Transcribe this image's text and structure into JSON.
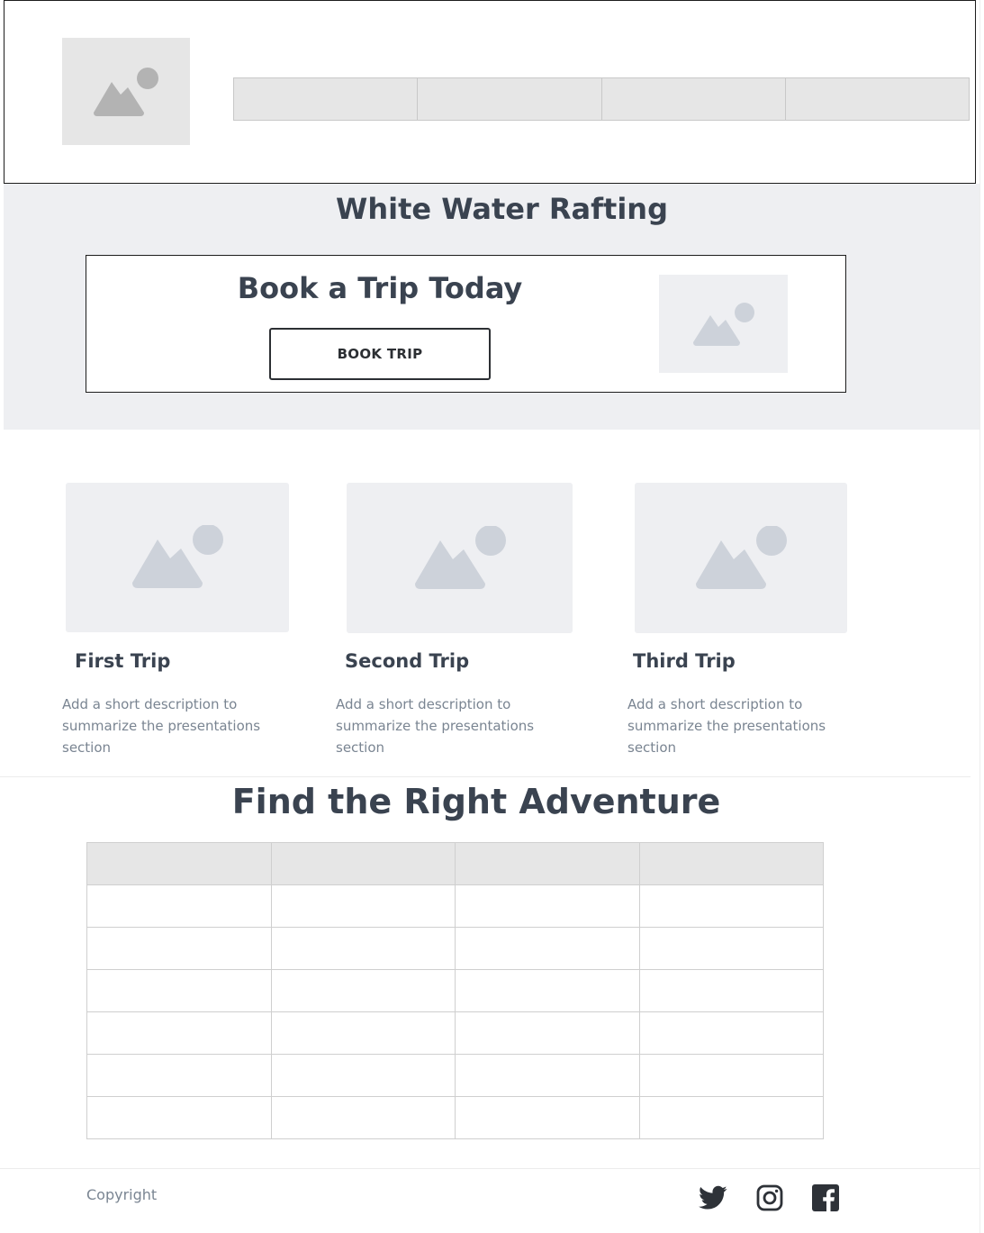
{
  "hero": {
    "title": "White Water Rafting",
    "card_title": "Book a Trip Today",
    "book_button": "BOOK TRIP"
  },
  "trips": [
    {
      "title": "First Trip",
      "description": "Add a short description to summarize the presentations section"
    },
    {
      "title": "Second Trip",
      "description": "Add a short description to summarize the presentations section"
    },
    {
      "title": "Third Trip",
      "description": "Add a short description to summarize the presentations section"
    }
  ],
  "adventure": {
    "title": "Find the Right Adventure"
  },
  "footer": {
    "copyright": "Copyright",
    "social_icons": [
      "twitter-icon",
      "instagram-icon",
      "facebook-icon"
    ]
  },
  "colors": {
    "heading": "#3a4350",
    "muted_text": "#7a8592",
    "placeholder_bg": "#eeeff2",
    "nav_bg": "#e6e6e6",
    "placeholder_icon": "#cdd2da"
  }
}
